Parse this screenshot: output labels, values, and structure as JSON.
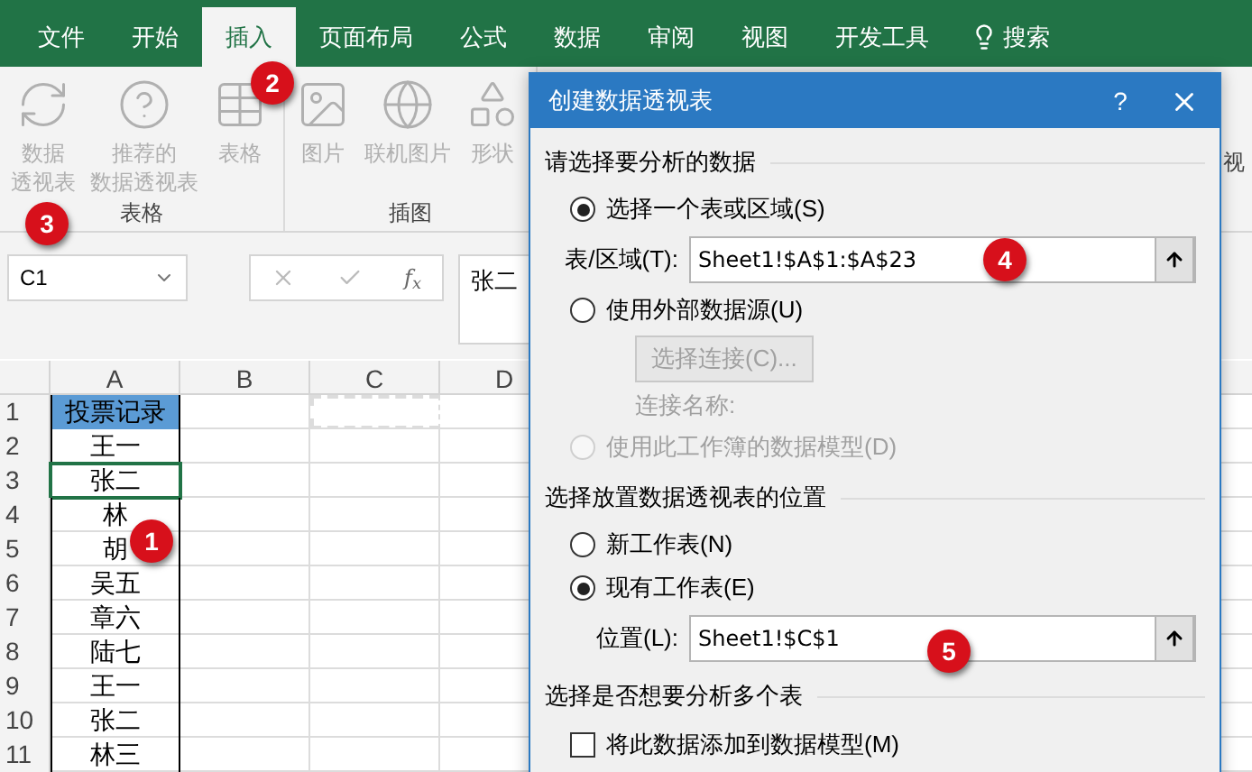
{
  "menu_tabs": [
    {
      "label": "文件",
      "selected": false
    },
    {
      "label": "开始",
      "selected": false
    },
    {
      "label": "插入",
      "selected": true
    },
    {
      "label": "页面布局",
      "selected": false
    },
    {
      "label": "公式",
      "selected": false
    },
    {
      "label": "数据",
      "selected": false
    },
    {
      "label": "审阅",
      "selected": false
    },
    {
      "label": "视图",
      "selected": false
    },
    {
      "label": "开发工具",
      "selected": false
    }
  ],
  "tell_me": "搜索",
  "ribbon": {
    "groups": [
      {
        "label": "表格",
        "commands": [
          {
            "kind": "pivot",
            "lines": [
              "数据",
              "透视表"
            ]
          },
          {
            "kind": "recommended",
            "lines": [
              "推荐的",
              "数据透视表"
            ]
          },
          {
            "kind": "table",
            "lines": [
              "表格"
            ]
          }
        ]
      },
      {
        "label": "插图",
        "commands": [
          {
            "kind": "picture",
            "lines": [
              "图片"
            ]
          },
          {
            "kind": "online",
            "lines": [
              "联机图片"
            ]
          },
          {
            "kind": "shape",
            "lines": [
              "形状"
            ]
          }
        ]
      }
    ],
    "edge_fragment": "视"
  },
  "formula_bar": {
    "name_box": "C1",
    "function": "f$_{x}$",
    "content": "张二"
  },
  "sheet": {
    "columns": [
      "A",
      "B",
      "C",
      "D"
    ],
    "rows": [
      {
        "number": "1",
        "a": "投票记录",
        "header": true,
        "selected": false,
        "marquee": true
      },
      {
        "number": "2",
        "a": "王一",
        "header": false,
        "selected": false,
        "marquee": false
      },
      {
        "number": "3",
        "a": "张二",
        "header": false,
        "selected": true,
        "marquee": false
      },
      {
        "number": "4",
        "a": "林",
        "header": false,
        "selected": false,
        "marquee": false
      },
      {
        "number": "5",
        "a": "胡",
        "header": false,
        "selected": false,
        "marquee": false
      },
      {
        "number": "6",
        "a": "吴五",
        "header": false,
        "selected": false,
        "marquee": false
      },
      {
        "number": "7",
        "a": "章六",
        "header": false,
        "selected": false,
        "marquee": false
      },
      {
        "number": "8",
        "a": "陆七",
        "header": false,
        "selected": false,
        "marquee": false
      },
      {
        "number": "9",
        "a": "王一",
        "header": false,
        "selected": false,
        "marquee": false
      },
      {
        "number": "10",
        "a": "张二",
        "header": false,
        "selected": false,
        "marquee": false
      },
      {
        "number": "11",
        "a": "林三",
        "header": false,
        "selected": false,
        "marquee": false
      }
    ]
  },
  "dialog": {
    "title": "创建数据透视表",
    "help": "?",
    "items": [
      {
        "kind": "section",
        "text": "请选择要分析的数据"
      },
      {
        "kind": "radio",
        "text": "选择一个表或区域(S)",
        "selected": true,
        "disabled": false
      },
      {
        "kind": "field",
        "label": "表/区域(T):",
        "value": "Sheet1!$A$1:$A$23"
      },
      {
        "kind": "radio",
        "text": "使用外部数据源(U)",
        "selected": false,
        "disabled": false
      },
      {
        "kind": "button",
        "text": "选择连接(C)...",
        "disabled": true
      },
      {
        "kind": "label",
        "text": "连接名称:",
        "disabled": true
      },
      {
        "kind": "radio",
        "text": "使用此工作簿的数据模型(D)",
        "selected": false,
        "disabled": true
      },
      {
        "kind": "section",
        "text": "选择放置数据透视表的位置"
      },
      {
        "kind": "radio",
        "text": "新工作表(N)",
        "selected": false,
        "disabled": false
      },
      {
        "kind": "radio",
        "text": "现有工作表(E)",
        "selected": true,
        "disabled": false
      },
      {
        "kind": "field",
        "label": "位置(L):",
        "value": "Sheet1!$C$1"
      },
      {
        "kind": "section",
        "text": "选择是否想要分析多个表"
      },
      {
        "kind": "checkbox",
        "text": "将此数据添加到数据模型(M)",
        "checked": false
      }
    ]
  },
  "badges": [
    "1",
    "2",
    "3",
    "4",
    "5"
  ]
}
